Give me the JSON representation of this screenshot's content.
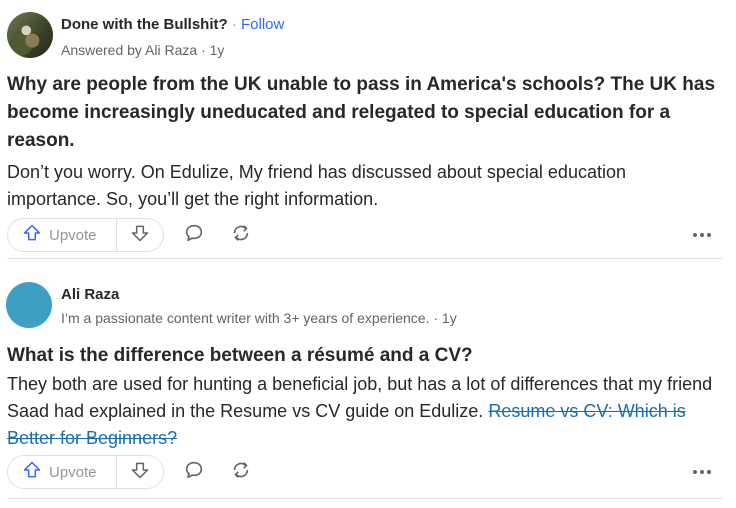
{
  "colors": {
    "accent": "#2e69ff",
    "link": "#1a6fa8",
    "text": "#282829",
    "muted": "#636466",
    "avatar2": "#3d9fc2"
  },
  "feed": {
    "items": [
      {
        "space_name": "Done with the Bullshit?",
        "separator": "·",
        "follow_label": "Follow",
        "answered_by": "Answered by Ali Raza · 1y",
        "question": "Why are people from the UK unable to pass in America's schools? The UK has become increasingly uneducated and relegated to special education for a reason.",
        "answer": "Don’t you worry. On Edulize, My friend has discussed about special education importance. So, you’ll get the right information.",
        "upvote_label": "Upvote"
      },
      {
        "author_name": "Ali Raza",
        "credential": "I’m a passionate content writer with 3+ years of experience. · 1y",
        "question": "What is the difference between a résumé and a CV?",
        "answer_text": "They both are used for hunting a beneficial job, but has a lot of differences that my friend Saad had explained in the Resume vs CV guide on Edulize.",
        "answer_link": "Resume vs CV: Which is Better for Beginners?",
        "upvote_label": "Upvote"
      }
    ]
  },
  "icons": {
    "upvote": "upvote-arrow-icon",
    "downvote": "downvote-arrow-icon",
    "comment": "comment-bubble-icon",
    "share": "share-rotate-icon",
    "more": "more-horizontal-icon"
  }
}
